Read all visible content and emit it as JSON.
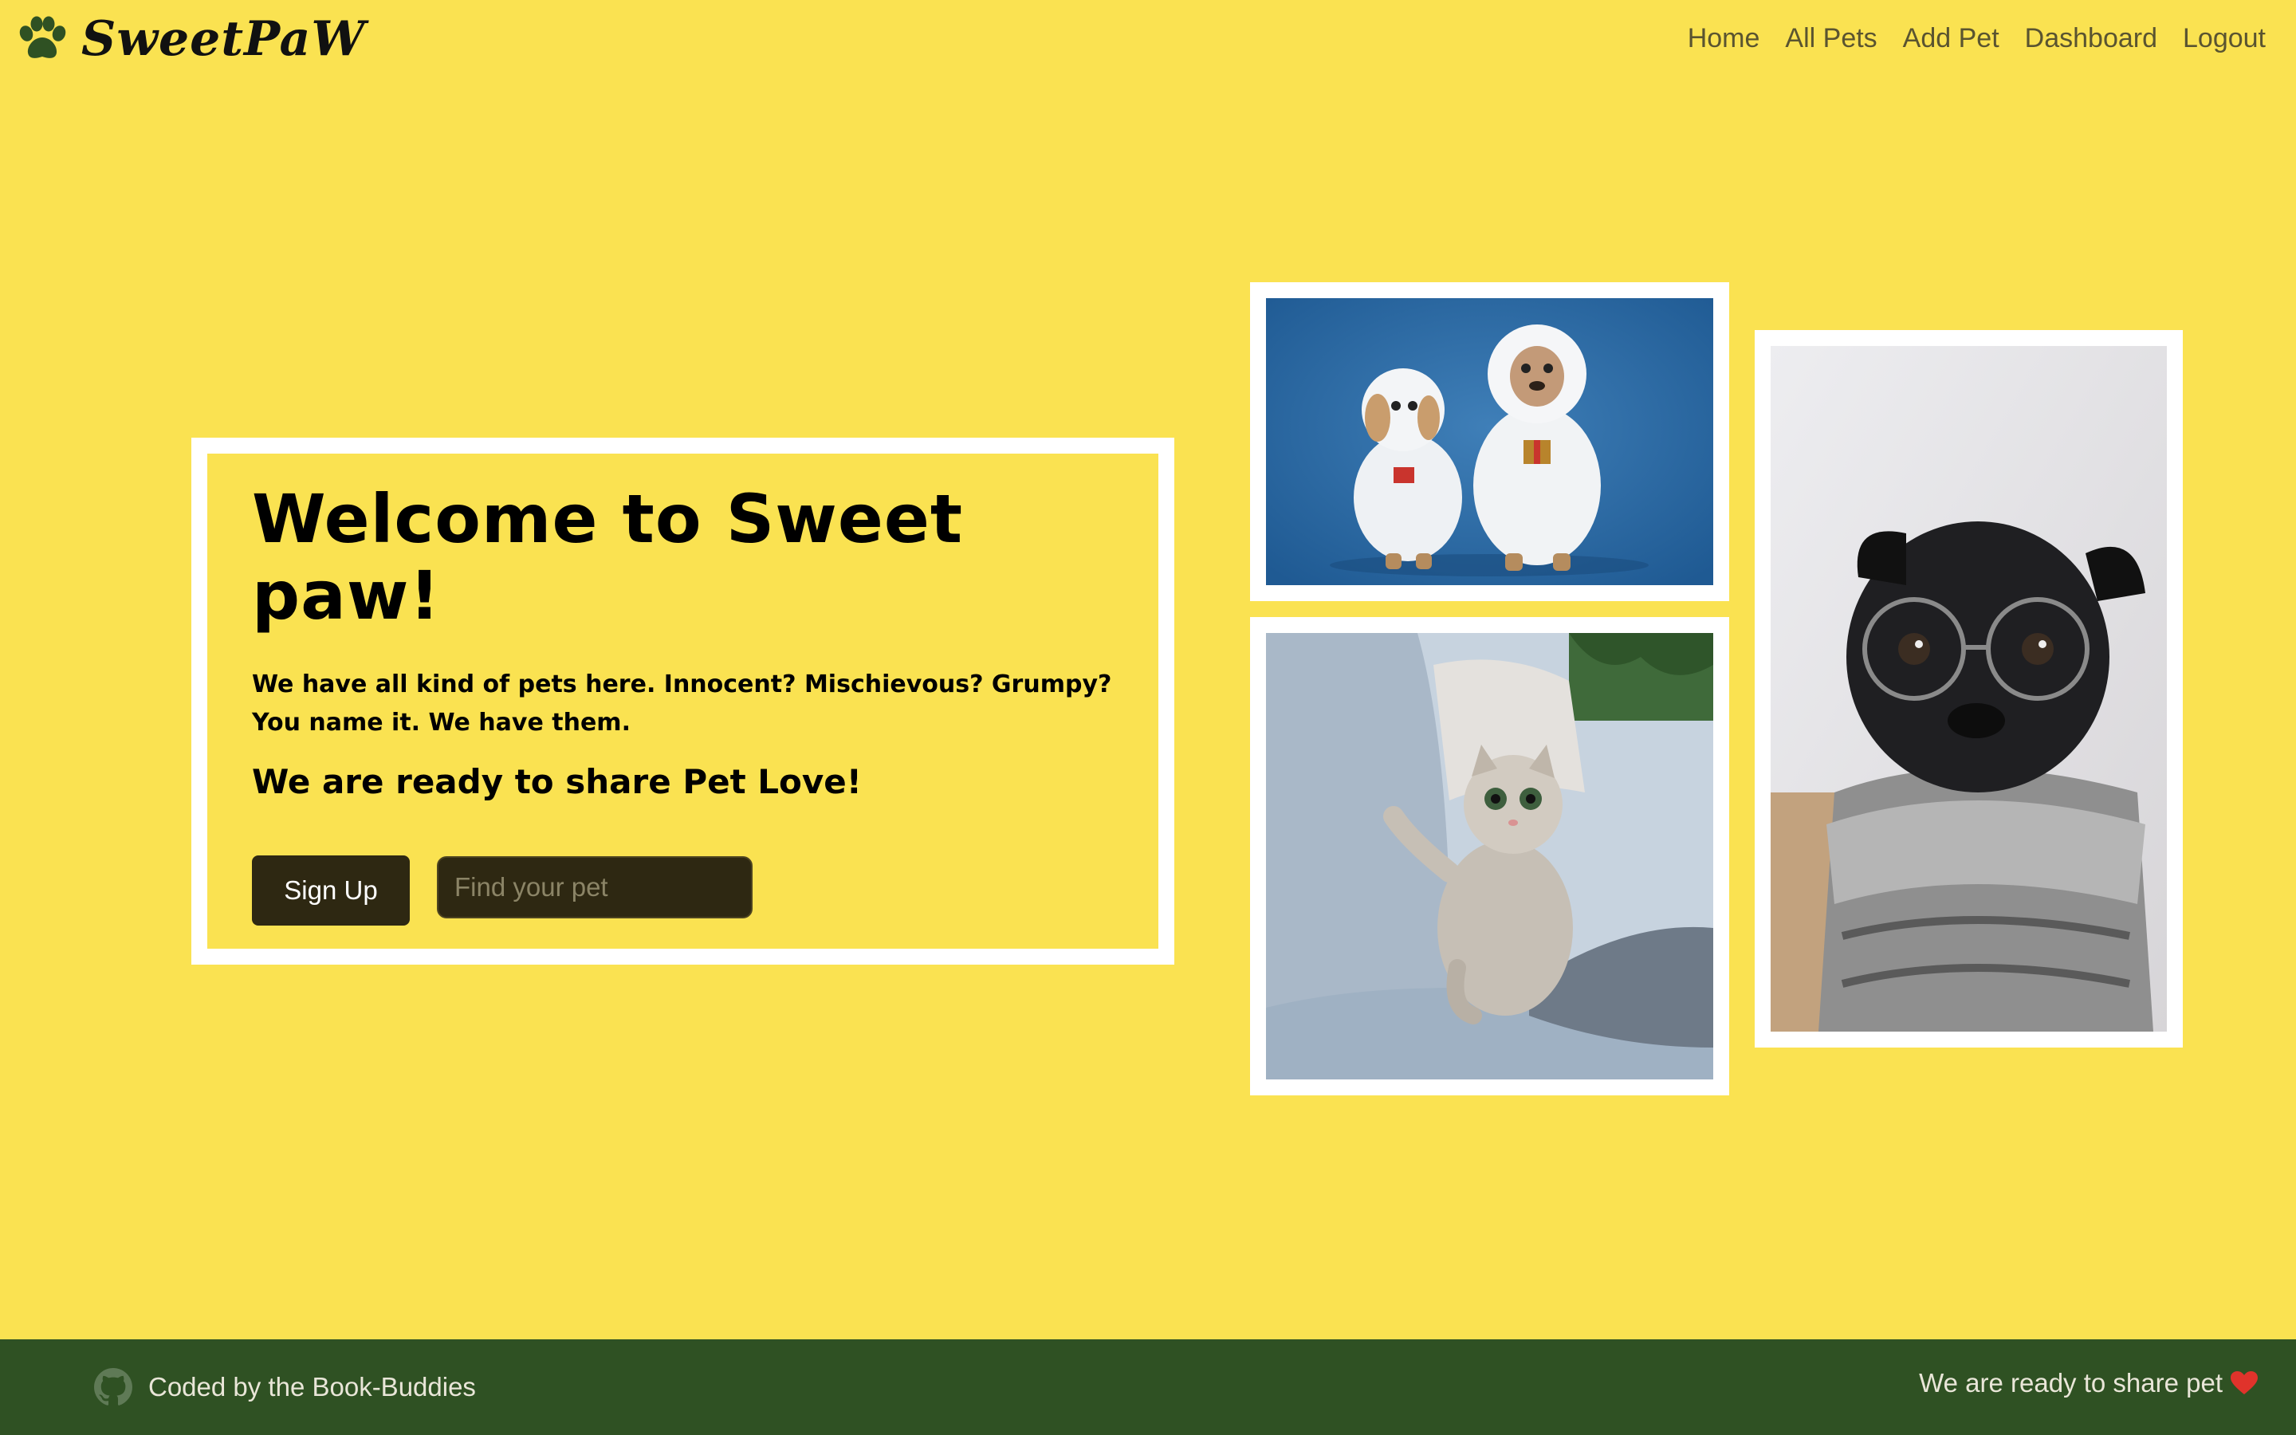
{
  "brand": {
    "name": "SweetPaW",
    "logo_icon": "paw-icon",
    "logo_color": "#2f5123"
  },
  "nav": {
    "items": [
      {
        "label": "Home"
      },
      {
        "label": "All Pets"
      },
      {
        "label": "Add Pet"
      },
      {
        "label": "Dashboard"
      },
      {
        "label": "Logout"
      }
    ]
  },
  "welcome": {
    "title": "Welcome to Sweet paw!",
    "description": "We have all kind of pets here. Innocent? Mischievous? Grumpy? You name it. We have them.",
    "tagline": "We are ready to share Pet Love!",
    "signup_label": "Sign Up",
    "search_placeholder": "Find your pet",
    "search_value": ""
  },
  "photos": [
    {
      "subject": "two small dogs in white fluffy costumes on blue background"
    },
    {
      "subject": "tabby kitten on a grey couch"
    },
    {
      "subject": "black pug wearing glasses and a knit scarf"
    }
  ],
  "footer": {
    "credit": "Coded by the Book-Buddies",
    "credit_icon": "github-icon",
    "tagline": "We are ready to share pet",
    "tagline_icon": "heart-icon",
    "heart_color": "#e0332b"
  },
  "colors": {
    "background": "#fae251",
    "footer_bg": "#2f5123",
    "button_bg": "#2e2812",
    "card_border": "#ffffff"
  }
}
